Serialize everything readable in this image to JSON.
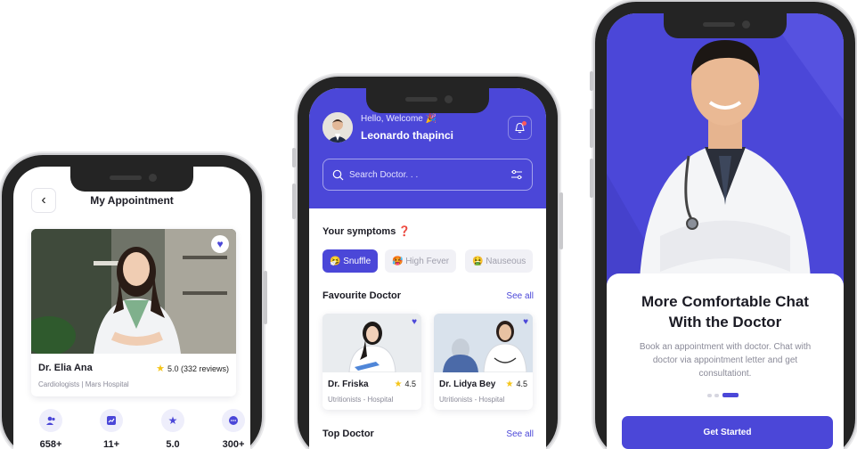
{
  "colors": {
    "accent": "#4b47d8",
    "star": "#f5c518",
    "muted": "#8a8a98"
  },
  "appointment": {
    "title": "My Appointment",
    "back_icon": "chevron-left-icon",
    "doctor": {
      "name": "Dr. Elia Ana",
      "rating": "5.0 (332 reviews)",
      "specialty": "Cardiologists | Mars Hospital"
    },
    "stats": [
      {
        "icon": "patients-icon",
        "value": "658+"
      },
      {
        "icon": "experience-icon",
        "value": "11+"
      },
      {
        "icon": "star-icon",
        "value": "5.0"
      },
      {
        "icon": "chat-icon",
        "value": "300+"
      }
    ]
  },
  "home": {
    "greeting": "Hello, Welcome 🎉",
    "username": "Leonardo thapinci",
    "search_placeholder": "Search Doctor. . .",
    "symptoms_title": "Your symptoms ❓",
    "symptoms": [
      {
        "label": "🤧 Snuffle",
        "active": true
      },
      {
        "label": "🥵 High Fever",
        "active": false
      },
      {
        "label": "🤮 Nauseous",
        "active": false
      }
    ],
    "favourite_title": "Favourite Doctor",
    "see_all": "See all",
    "favourites": [
      {
        "name": "Dr. Friska",
        "rating": "4.5",
        "sub": "Utritionists - Hospital"
      },
      {
        "name": "Dr. Lidya Bey",
        "rating": "4.5",
        "sub": "Utritionists - Hospital"
      }
    ],
    "top_title": "Top Doctor",
    "top_see_all": "See all"
  },
  "onboarding": {
    "title": "More Comfortable Chat With the Doctor",
    "body": "Book an appointment with doctor. Chat with doctor via appointment letter and get consultationt.",
    "page_index": 2,
    "page_count": 3,
    "cta": "Get Started"
  }
}
